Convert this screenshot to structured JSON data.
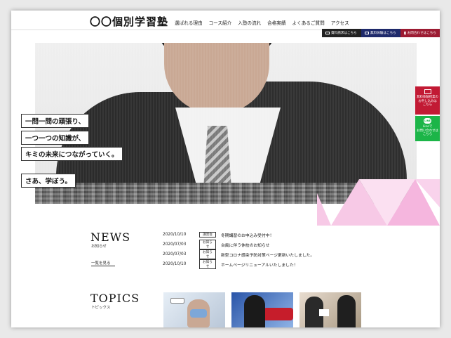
{
  "header": {
    "logo": "〇〇個別学習塾",
    "nav": [
      "選ばれる理由",
      "コース紹介",
      "入塾の流れ",
      "合格実績",
      "よくあるご質問",
      "アクセス"
    ],
    "contact_buttons": [
      "資料請求はこちら",
      "無料体験はこちら",
      "お問合わせはこちら"
    ]
  },
  "hero": {
    "catch_lines": [
      "一問一問の頑張り、",
      "一つ一つの知識が、",
      "キミの未来につながっていく。"
    ],
    "catch_cta": "さあ、学ぼう。"
  },
  "side": {
    "trial_label": "無料体験授業の\nお申し込みは\nこちら",
    "line_icon_text": "LINE",
    "line_label": "Lineで\nお問い合わせは\nこちら"
  },
  "news": {
    "title": "NEWS",
    "subtitle": "お知らせ",
    "more": "一覧を見る",
    "items": [
      {
        "date": "2020/10/10",
        "badge": "講習会",
        "text": "冬期講習のお申込み受付中！"
      },
      {
        "date": "2020/07/03",
        "badge": "お知らせ",
        "text": "台風に伴う休校のお知らせ"
      },
      {
        "date": "2020/07/03",
        "badge": "お知らせ",
        "text": "新型コロナ感染予防対策ページ更新いたしました。"
      },
      {
        "date": "2020/10/10",
        "badge": "お知らせ",
        "text": "ホームページリニューアルいたしました！"
      }
    ]
  },
  "topics": {
    "title": "TOPICS",
    "subtitle": "トピックス"
  },
  "colors": {
    "accent_red": "#c21a34",
    "line_green": "#1cb548",
    "navy": "#1f2a6b"
  }
}
